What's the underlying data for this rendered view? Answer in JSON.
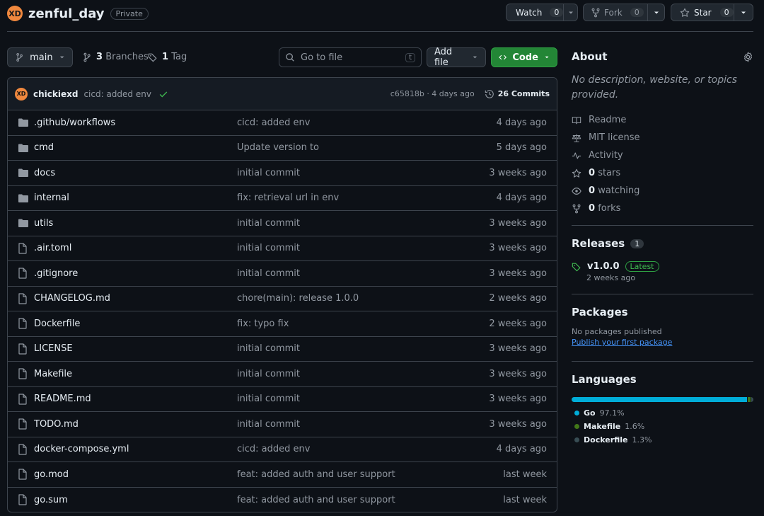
{
  "repo": {
    "name": "zenful_day",
    "visibility": "Private",
    "avatar_text": "XD"
  },
  "actions": {
    "watch": {
      "label": "Watch",
      "count": "0"
    },
    "fork": {
      "label": "Fork",
      "count": "0"
    },
    "star": {
      "label": "Star",
      "count": "0"
    }
  },
  "toolbar": {
    "branch": "main",
    "branches_count": "3",
    "branches_label": "Branches",
    "tags_count": "1",
    "tags_label": "Tag",
    "search_placeholder": "Go to file",
    "search_kbd": "t",
    "add_file": "Add file",
    "code": "Code"
  },
  "last_commit": {
    "author": "chickiexd",
    "message": "cicd: added env",
    "hash_time": "c65818b · 4 days ago",
    "commits_label": "26 Commits"
  },
  "files": [
    {
      "type": "dir",
      "name": ".github/workflows",
      "message": "cicd: added env",
      "date": "4 days ago"
    },
    {
      "type": "dir",
      "name": "cmd",
      "message": "Update version to",
      "date": "5 days ago"
    },
    {
      "type": "dir",
      "name": "docs",
      "message": "initial commit",
      "date": "3 weeks ago"
    },
    {
      "type": "dir",
      "name": "internal",
      "message": "fix: retrieval url in env",
      "date": "4 days ago"
    },
    {
      "type": "dir",
      "name": "utils",
      "message": "initial commit",
      "date": "3 weeks ago"
    },
    {
      "type": "file",
      "name": ".air.toml",
      "message": "initial commit",
      "date": "3 weeks ago"
    },
    {
      "type": "file",
      "name": ".gitignore",
      "message": "initial commit",
      "date": "3 weeks ago"
    },
    {
      "type": "file",
      "name": "CHANGELOG.md",
      "message": "chore(main): release 1.0.0",
      "date": "2 weeks ago"
    },
    {
      "type": "file",
      "name": "Dockerfile",
      "message": "fix: typo fix",
      "date": "2 weeks ago"
    },
    {
      "type": "file",
      "name": "LICENSE",
      "message": "initial commit",
      "date": "3 weeks ago"
    },
    {
      "type": "file",
      "name": "Makefile",
      "message": "initial commit",
      "date": "3 weeks ago"
    },
    {
      "type": "file",
      "name": "README.md",
      "message": "initial commit",
      "date": "3 weeks ago"
    },
    {
      "type": "file",
      "name": "TODO.md",
      "message": "initial commit",
      "date": "3 weeks ago"
    },
    {
      "type": "file",
      "name": "docker-compose.yml",
      "message": "cicd: added env",
      "date": "4 days ago"
    },
    {
      "type": "file",
      "name": "go.mod",
      "message": "feat: added auth and user support",
      "date": "last week"
    },
    {
      "type": "file",
      "name": "go.sum",
      "message": "feat: added auth and user support",
      "date": "last week"
    }
  ],
  "about": {
    "title": "About",
    "description": "No description, website, or topics provided.",
    "readme": "Readme",
    "license": "MIT license",
    "activity": "Activity",
    "stars_count": "0",
    "stars_label": "stars",
    "watching_count": "0",
    "watching_label": "watching",
    "forks_count": "0",
    "forks_label": "forks"
  },
  "releases": {
    "title": "Releases",
    "count": "1",
    "tag": "v1.0.0",
    "latest": "Latest",
    "when": "2 weeks ago"
  },
  "packages": {
    "title": "Packages",
    "none": "No packages published",
    "publish_link": "Publish your first package"
  },
  "languages": {
    "title": "Languages",
    "items": [
      {
        "name": "Go",
        "percent": "97.1%",
        "share": 97.1,
        "color": "#00ADD8"
      },
      {
        "name": "Makefile",
        "percent": "1.6%",
        "share": 1.6,
        "color": "#427819"
      },
      {
        "name": "Dockerfile",
        "percent": "1.3%",
        "share": 1.3,
        "color": "#384d54"
      }
    ]
  },
  "colors": {
    "accent_green": "#238636",
    "link": "#4493f8",
    "bg": "#0d1117"
  }
}
